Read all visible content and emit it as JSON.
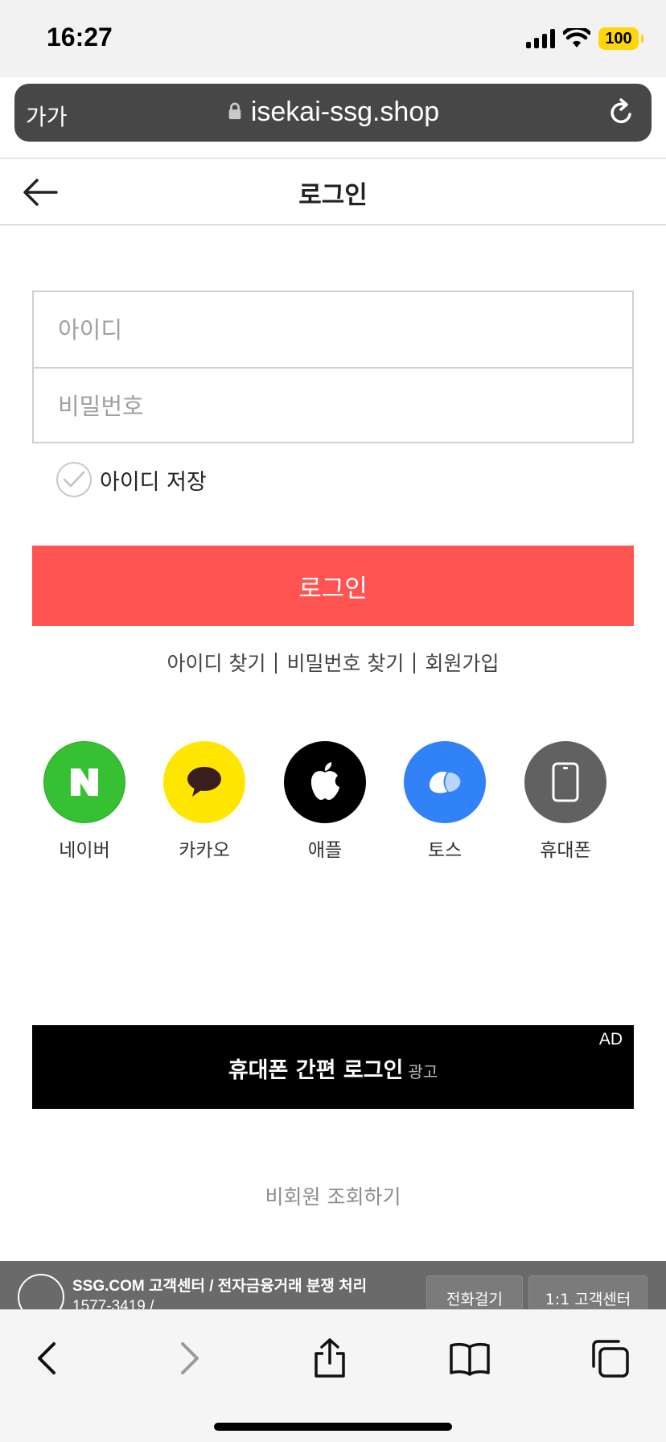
{
  "status": {
    "time": "16:27",
    "battery": "100",
    "battery_color": "#ffd60a"
  },
  "browser": {
    "reader_label": "가가",
    "url": "isekai-ssg.shop"
  },
  "header": {
    "title": "로그인"
  },
  "form": {
    "id_placeholder": "아이디",
    "password_placeholder": "비밀번호",
    "id_value": "",
    "password_value": "",
    "save_id_label": "아이디 저장",
    "login_button": "로그인",
    "login_button_color": "#ff5451"
  },
  "links": {
    "find_id": "아이디 찾기",
    "find_password": "비밀번호 찾기",
    "signup": "회원가입"
  },
  "social": [
    {
      "label": "네이버",
      "icon": "naver-icon",
      "color": "#37c032"
    },
    {
      "label": "카카오",
      "icon": "kakao-icon",
      "color": "#ffe600"
    },
    {
      "label": "애플",
      "icon": "apple-icon",
      "color": "#000000"
    },
    {
      "label": "토스",
      "icon": "toss-icon",
      "color": "#3182f6"
    },
    {
      "label": "휴대폰",
      "icon": "phone-icon",
      "color": "#616161"
    }
  ],
  "ad": {
    "tag": "AD",
    "title": "휴대폰 간편 로그인",
    "small": "광고"
  },
  "guest": {
    "label": "비회원 조회하기"
  },
  "footer": {
    "title": "SSG.COM 고객센터 / 전자금융거래 분쟁 처리",
    "phone": "1577-3419 /",
    "call_button": "전화걸기",
    "center_button": "1:1 고객센터"
  }
}
